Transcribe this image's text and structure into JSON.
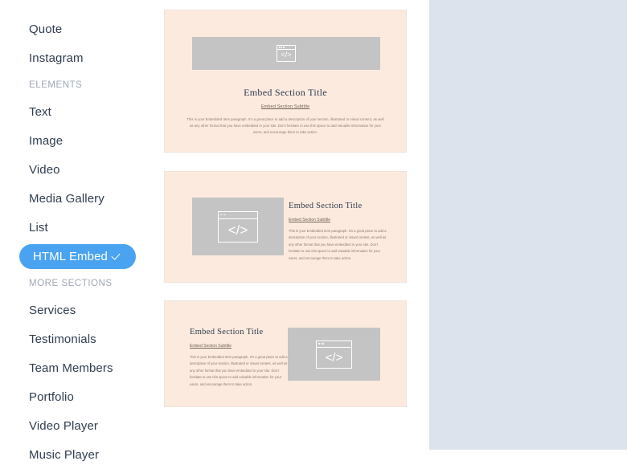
{
  "sidebar": {
    "items": [
      {
        "type": "item",
        "label": "Quote",
        "selected": false
      },
      {
        "type": "item",
        "label": "Instagram",
        "selected": false
      },
      {
        "type": "group",
        "label": "ELEMENTS",
        "selected": false
      },
      {
        "type": "item",
        "label": "Text",
        "selected": false
      },
      {
        "type": "item",
        "label": "Image",
        "selected": false
      },
      {
        "type": "item",
        "label": "Video",
        "selected": false
      },
      {
        "type": "item",
        "label": "Media Gallery",
        "selected": false
      },
      {
        "type": "item",
        "label": "List",
        "selected": false
      },
      {
        "type": "item",
        "label": "HTML Embed",
        "selected": true
      },
      {
        "type": "group",
        "label": "MORE SECTIONS",
        "selected": false
      },
      {
        "type": "item",
        "label": "Services",
        "selected": false
      },
      {
        "type": "item",
        "label": "Testimonials",
        "selected": false
      },
      {
        "type": "item",
        "label": "Team Members",
        "selected": false
      },
      {
        "type": "item",
        "label": "Portfolio",
        "selected": false
      },
      {
        "type": "item",
        "label": "Video Player",
        "selected": false
      },
      {
        "type": "item",
        "label": "Music Player",
        "selected": false
      }
    ],
    "selected_check_glyph": "check-icon",
    "accent_color": "#4aa3f0",
    "text_color": "#2f3e50",
    "group_label_color": "#9fa9b5"
  },
  "cards": {
    "background_color": "#fceade",
    "placeholder_color": "#c4c4c4",
    "icon_name": "code-embed-icon",
    "icon_glyph": "</>",
    "items": [
      {
        "layout": "stacked-centered",
        "title": "Embed Section Title",
        "subtitle": "Embed Section Subtitle",
        "body": "This is your Embedded Item paragraph. It's a great place to add a description of your section, illustrated or visual content, as well as any other format that you have embedded in your site. Don't hesitate to use this space to add valuable information for your users, and encourage them to take action."
      },
      {
        "layout": "image-left",
        "title": "Embed Section Title",
        "subtitle": "Embed Section Subtitle",
        "body": "This is your Embedded Item paragraph. It's a great place to add a description of your section, illustrated or visual content, as well as any other format that you have embedded in your site. Don't hesitate to use this space to add valuable information for your users, and encourage them to take action."
      },
      {
        "layout": "image-right",
        "title": "Embed Section Title",
        "subtitle": "Embed Section Subtitle",
        "body": "This is your Embedded Item paragraph. It's a great place to add a description of your section, illustrated or visual content, as well as any other format that you have embedded in your site. Don't hesitate to use this space to add valuable information for your users, and encourage them to take action."
      }
    ]
  },
  "right_panel": {
    "background_color": "#dce3ec"
  }
}
